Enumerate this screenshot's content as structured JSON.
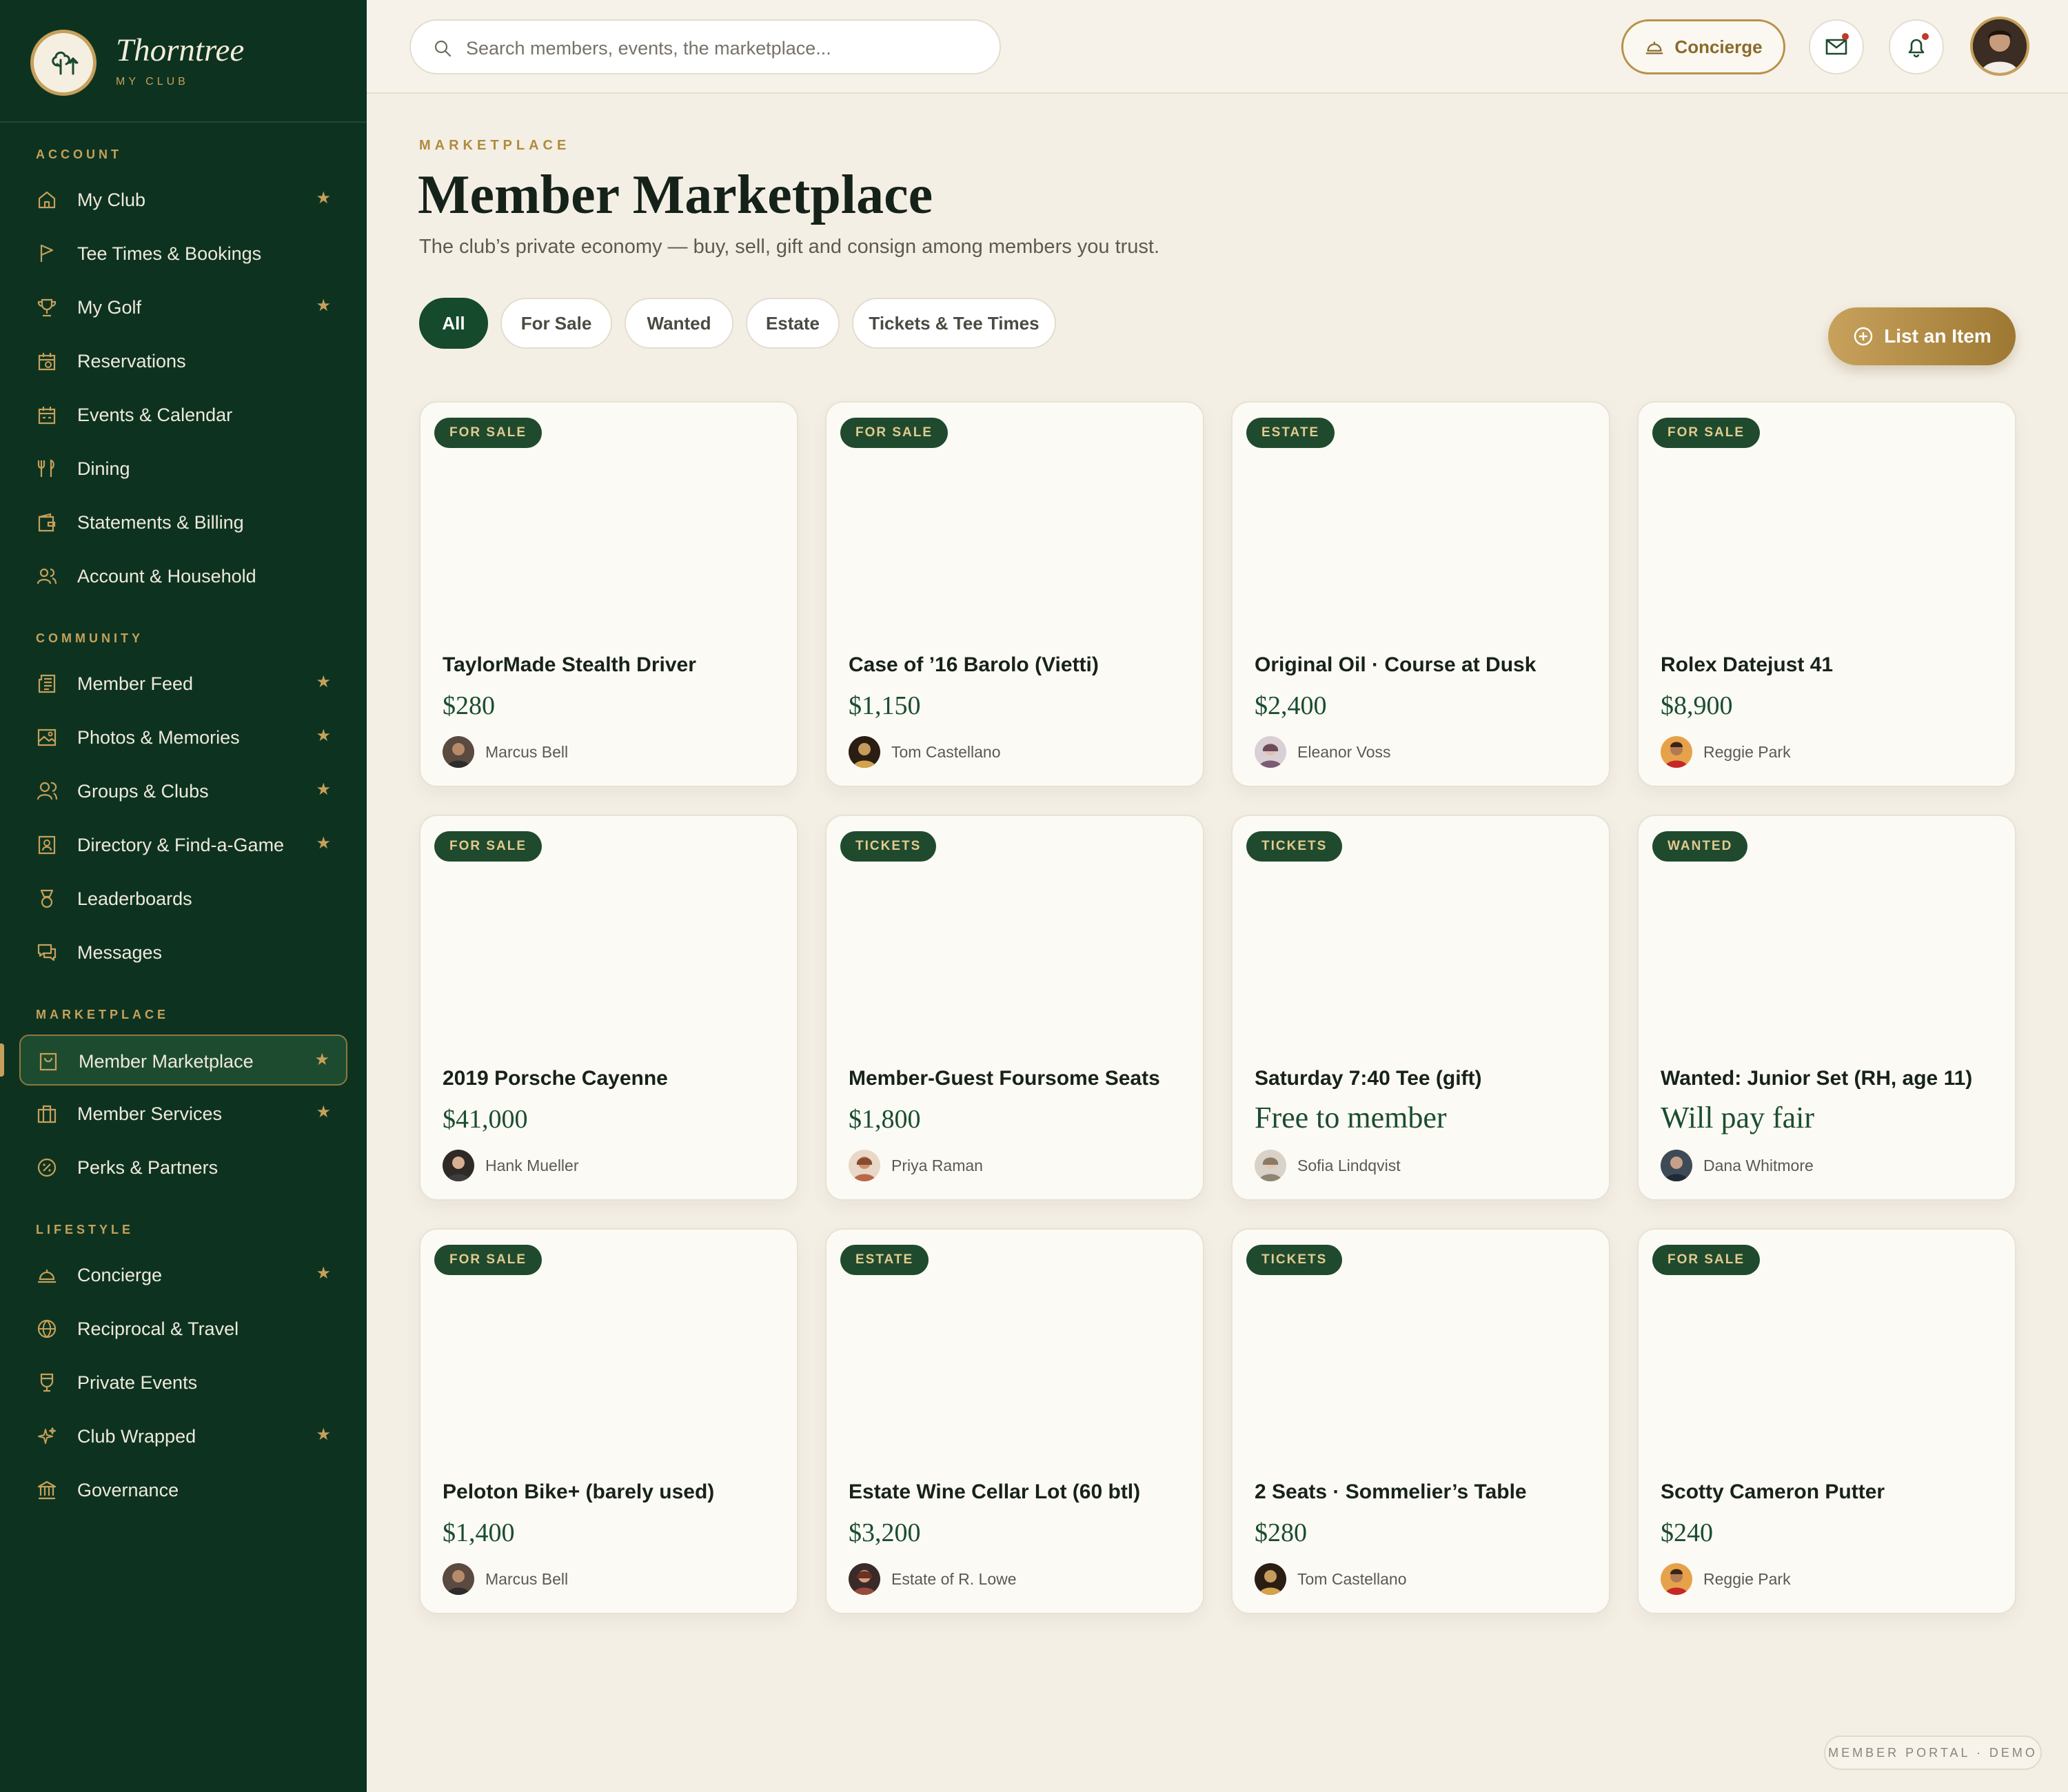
{
  "brand": {
    "name": "Thorntree",
    "sub": "MY CLUB"
  },
  "sidebar": {
    "sections": [
      {
        "label": "ACCOUNT",
        "items": [
          {
            "label": "My Club",
            "star": true
          },
          {
            "label": "Tee Times & Bookings",
            "star": false
          },
          {
            "label": "My Golf",
            "star": true
          },
          {
            "label": "Reservations",
            "star": false
          },
          {
            "label": "Events & Calendar",
            "star": false
          },
          {
            "label": "Dining",
            "star": false
          },
          {
            "label": "Statements & Billing",
            "star": false
          },
          {
            "label": "Account & Household",
            "star": false
          }
        ]
      },
      {
        "label": "COMMUNITY",
        "items": [
          {
            "label": "Member Feed",
            "star": true
          },
          {
            "label": "Photos & Memories",
            "star": true
          },
          {
            "label": "Groups & Clubs",
            "star": true
          },
          {
            "label": "Directory & Find-a-Game",
            "star": true
          },
          {
            "label": "Leaderboards",
            "star": false
          },
          {
            "label": "Messages",
            "star": false
          }
        ]
      },
      {
        "label": "MARKETPLACE",
        "items": [
          {
            "label": "Member Marketplace",
            "star": true,
            "active": true
          },
          {
            "label": "Member Services",
            "star": true
          },
          {
            "label": "Perks & Partners",
            "star": false
          }
        ]
      },
      {
        "label": "LIFESTYLE",
        "items": [
          {
            "label": "Concierge",
            "star": true
          },
          {
            "label": "Reciprocal & Travel",
            "star": false
          },
          {
            "label": "Private Events",
            "star": false
          },
          {
            "label": "Club Wrapped",
            "star": true
          },
          {
            "label": "Governance",
            "star": false
          }
        ]
      }
    ],
    "star_glyph": "★"
  },
  "topbar": {
    "search_placeholder": "Search members, events, the marketplace...",
    "concierge_label": "Concierge"
  },
  "page": {
    "eyebrow": "MARKETPLACE",
    "title": "Member Marketplace",
    "subtitle": "The club’s private economy — buy, sell, gift and consign among members you trust.",
    "filters": [
      "All",
      "For Sale",
      "Wanted",
      "Estate",
      "Tickets & Tee Times"
    ],
    "active_filter": "All",
    "list_button": "List an Item"
  },
  "listings": [
    {
      "badge": "FOR SALE",
      "title": "TaylorMade Stealth Driver",
      "price": "$280",
      "seller": "Marcus Bell"
    },
    {
      "badge": "FOR SALE",
      "title": "Case of ’16 Barolo (Vietti)",
      "price": "$1,150",
      "seller": "Tom Castellano"
    },
    {
      "badge": "ESTATE",
      "title": "Original Oil · Course at Dusk",
      "price": "$2,400",
      "seller": "Eleanor Voss"
    },
    {
      "badge": "FOR SALE",
      "title": "Rolex Datejust 41",
      "price": "$8,900",
      "seller": "Reggie Park"
    },
    {
      "badge": "FOR SALE",
      "title": "2019 Porsche Cayenne",
      "price": "$41,000",
      "seller": "Hank Mueller"
    },
    {
      "badge": "TICKETS",
      "title": "Member-Guest Foursome Seats",
      "price": "$1,800",
      "seller": "Priya Raman"
    },
    {
      "badge": "TICKETS",
      "title": "Saturday 7:40 Tee (gift)",
      "price": "Free to member",
      "seller": "Sofia Lindqvist"
    },
    {
      "badge": "WANTED",
      "title": "Wanted: Junior Set (RH, age 11)",
      "price": "Will pay fair",
      "seller": "Dana Whitmore"
    },
    {
      "badge": "FOR SALE",
      "title": "Peloton Bike+ (barely used)",
      "price": "$1,400",
      "seller": "Marcus Bell"
    },
    {
      "badge": "ESTATE",
      "title": "Estate Wine Cellar Lot (60 btl)",
      "price": "$3,200",
      "seller": "Estate of R. Lowe"
    },
    {
      "badge": "TICKETS",
      "title": "2 Seats · Sommelier’s Table",
      "price": "$280",
      "seller": "Tom Castellano"
    },
    {
      "badge": "FOR SALE",
      "title": "Scotty Cameron Putter",
      "price": "$240",
      "seller": "Reggie Park"
    }
  ],
  "footer_tag": "MEMBER PORTAL · DEMO",
  "colors": {
    "sidebar": "#0d3320",
    "accent_gold": "#c6a05a",
    "price_green": "#1b4d30",
    "badge_bg": "#1f4a2e"
  }
}
